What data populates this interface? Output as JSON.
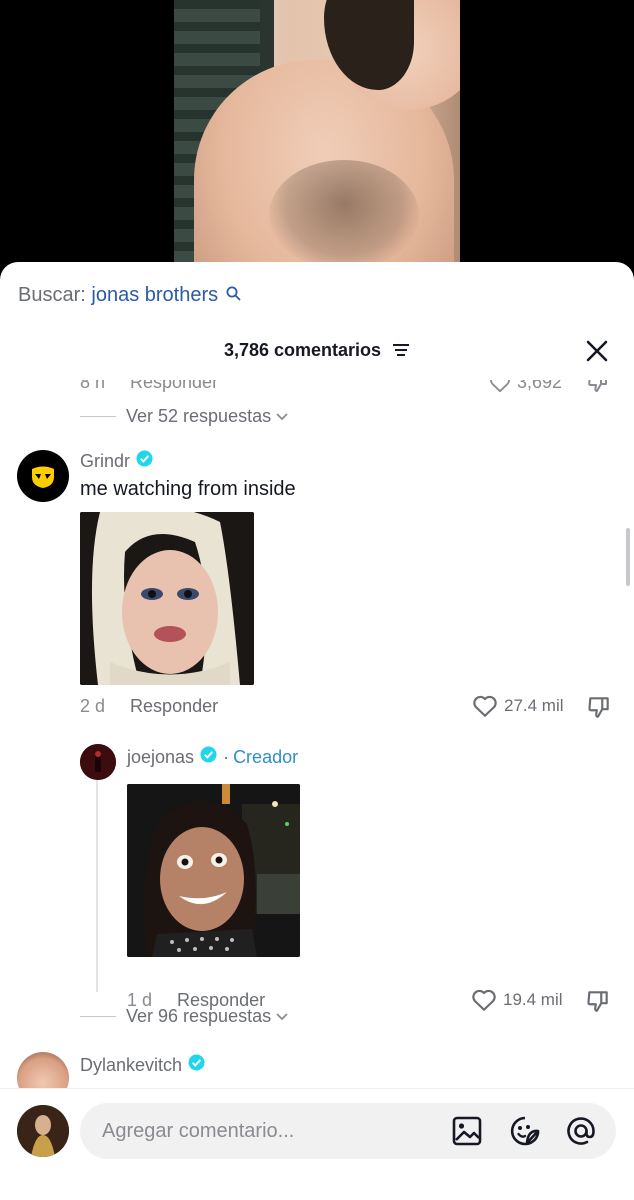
{
  "search": {
    "label": "Buscar:",
    "term": "jonas brothers"
  },
  "comments_header": {
    "count_label": "3,786 comentarios"
  },
  "partial_row": {
    "time": "8 h",
    "reply_label": "Responder",
    "likes": "3,692"
  },
  "thread_1": {
    "view_replies": "Ver 52 respuestas"
  },
  "comment_grindr": {
    "username": "Grindr",
    "text": "me watching from inside",
    "time": "2 d",
    "reply_label": "Responder",
    "likes": "27.4 mil"
  },
  "reply_joejonas": {
    "username": "joejonas",
    "separator": "·",
    "creator_label": "Creador",
    "time": "1 d",
    "reply_label": "Responder",
    "likes": "19.4 mil"
  },
  "thread_2": {
    "view_replies": "Ver 96 respuestas"
  },
  "comment_dylan": {
    "username": "Dylankevitch"
  },
  "composer": {
    "placeholder": "Agregar comentario..."
  },
  "colors": {
    "link_blue": "#2b5aa6",
    "creator_blue": "#2e8fc7",
    "verified": "#20d5ec",
    "grindr_yellow": "#ffcc00"
  },
  "icons": [
    "search-icon",
    "filter-icon",
    "close-icon",
    "verified-icon",
    "heart-icon",
    "dislike-icon",
    "chevron-down-icon",
    "image-icon",
    "emoji-icon",
    "mention-icon"
  ]
}
